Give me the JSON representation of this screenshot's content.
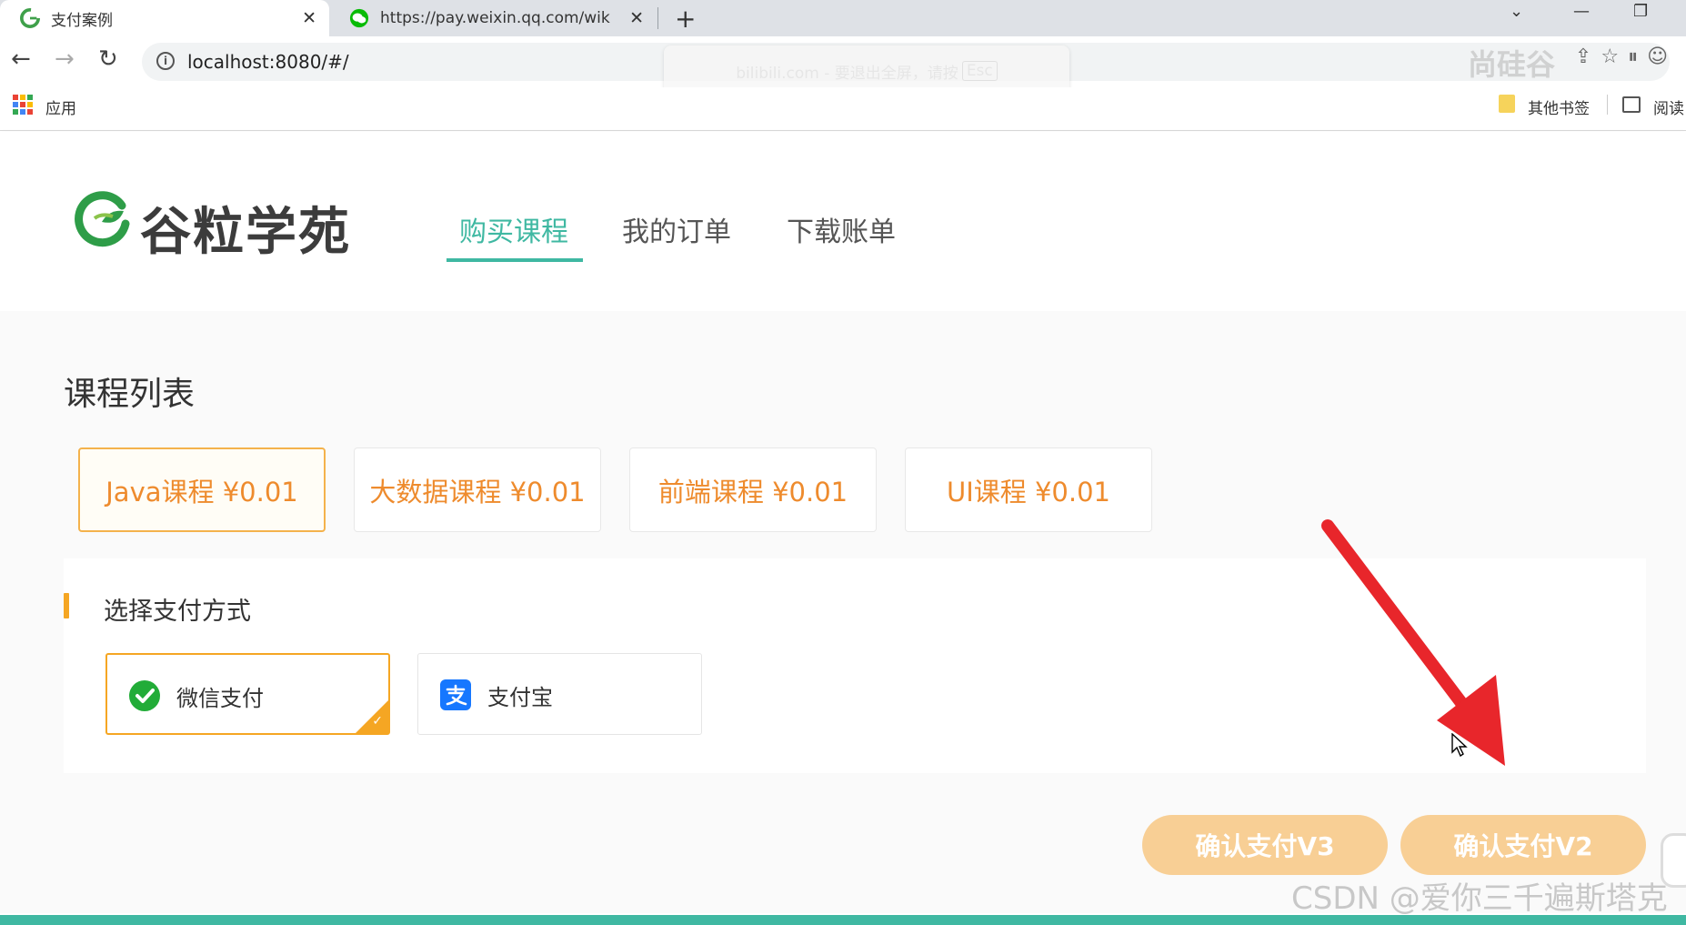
{
  "browser": {
    "tabs": [
      {
        "title": "支付案例",
        "active": true
      },
      {
        "title": "https://pay.weixin.qq.com/wik",
        "active": false
      }
    ],
    "address": "localhost:8080/#/",
    "fullscreen_toast": {
      "text": "bilibili.com - 要退出全屏，请按",
      "key": "Esc"
    },
    "top_watermark": "尚硅谷",
    "bookmarks": {
      "apps_label": "应用",
      "other_label": "其他书签",
      "reading_label": "阅读"
    }
  },
  "site": {
    "logo_text": "谷粒学苑",
    "nav": [
      {
        "label": "购买课程",
        "active": true
      },
      {
        "label": "我的订单",
        "active": false
      },
      {
        "label": "下载账单",
        "active": false
      }
    ],
    "accent_color": "#3fb8a2"
  },
  "courses": {
    "title": "课程列表",
    "items": [
      {
        "label": "Java课程 ¥0.01",
        "selected": true
      },
      {
        "label": "大数据课程 ¥0.01",
        "selected": false
      },
      {
        "label": "前端课程 ¥0.01",
        "selected": false
      },
      {
        "label": "UI课程 ¥0.01",
        "selected": false
      }
    ]
  },
  "payment": {
    "title": "选择支付方式",
    "methods": [
      {
        "label": "微信支付",
        "icon": "wechat-pay-icon",
        "selected": true
      },
      {
        "label": "支付宝",
        "icon": "alipay-icon",
        "selected": false
      }
    ],
    "confirm_v3": "确认支付V3",
    "confirm_v2": "确认支付V2",
    "button_color": "#f8cf95"
  },
  "watermark": "CSDN @爱你三千遍斯塔克"
}
